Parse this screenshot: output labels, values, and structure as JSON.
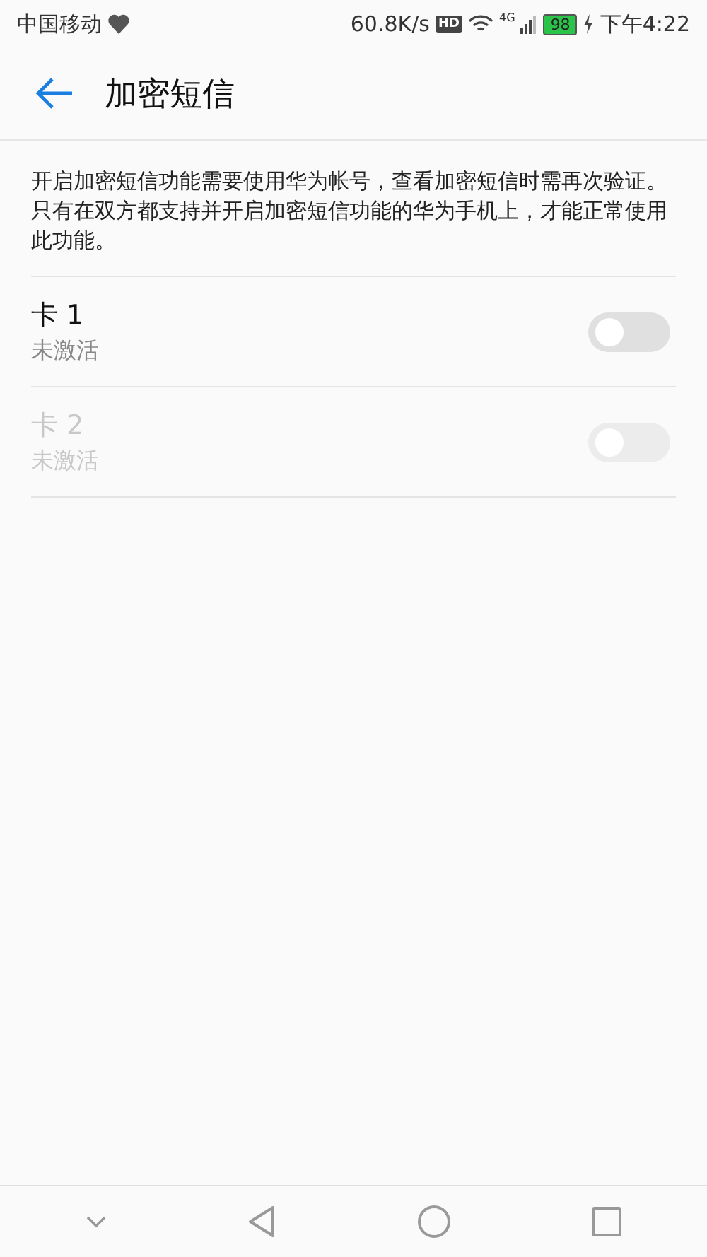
{
  "status_bar": {
    "carrier": "中国移动",
    "speed": "60.8K/s",
    "hd": "HD",
    "network": "4G",
    "battery": "98",
    "time": "下午4:22"
  },
  "header": {
    "title": "加密短信"
  },
  "description": "开启加密短信功能需要使用华为帐号，查看加密短信时需再次验证。只有在双方都支持并开启加密短信功能的华为手机上，才能正常使用此功能。",
  "cards": [
    {
      "name": "卡 1",
      "status": "未激活",
      "on": false,
      "disabled": false
    },
    {
      "name": "卡 2",
      "status": "未激活",
      "on": false,
      "disabled": true
    }
  ]
}
